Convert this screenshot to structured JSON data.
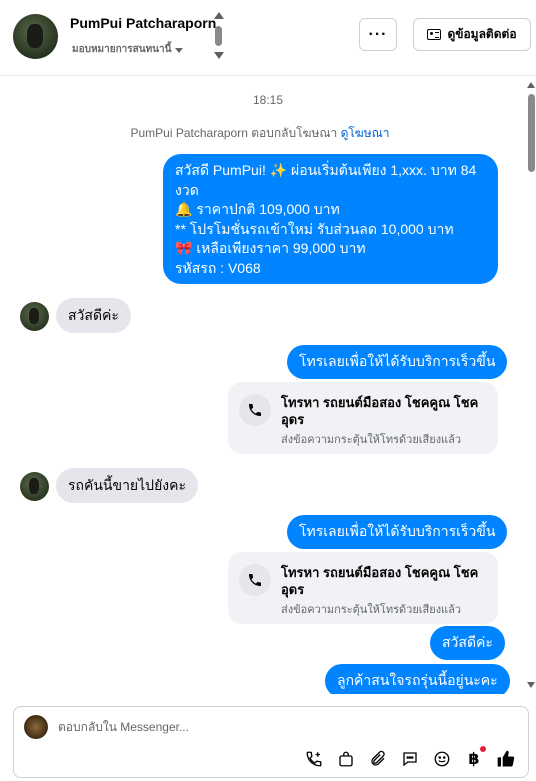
{
  "header": {
    "name": "PumPui Patcharaporn",
    "status": "มอบหมายการสนทนานี้",
    "more_label": "···",
    "contact_label": "ดูข้อมูลติดต่อ"
  },
  "chat": {
    "timestamp": "18:15",
    "notice_text": "PumPui Patcharaporn ตอบกลับโฆษณา",
    "notice_link": "ดูโฆษณา",
    "ad_message": [
      "สวัสดี PumPui! ✨  ผ่อนเริ่มต้นเพียง 1,xxx. บาท 84",
      "งวด",
      "🔔 ราคาปกติ 109,000 บาท",
      "** โปรโมชั่นรถเข้าใหม่ รับส่วนลด 10,000 บาท",
      "🎀  เหลือเพียงราคา 99,000 บาท",
      " รหัสรถ : V068"
    ],
    "incoming_1": "สวัสดีค่ะ",
    "call_button_1": "โทรเลยเพื่อให้ได้รับบริการเร็วขึ้น",
    "call_card_1": {
      "title": "โทรหา รถยนต์มือสอง โชคคูณ โชค อุดร",
      "subtitle": "ส่งข้อความกระตุ้นให้โทรด้วยเสียงแล้ว"
    },
    "incoming_2": "รถคันนี้ขายไปยังคะ",
    "call_button_2": "โทรเลยเพื่อให้ได้รับบริการเร็วขึ้น",
    "call_card_2": {
      "title": "โทรหา รถยนต์มือสอง โชคคูณ โชค อุดร",
      "subtitle": "ส่งข้อความกระตุ้นให้โทรด้วยเสียงแล้ว"
    },
    "outgoing_greeting": "สวัสดีค่ะ",
    "outgoing_last": "ลูกค้าสนใจรถรุ่นนี้อยู่นะคะ"
  },
  "composer": {
    "placeholder": "ตอบกลับใน Messenger...",
    "tools": [
      "add-call-icon",
      "shopping-bag-icon",
      "paperclip-icon",
      "saved-reply-icon",
      "emoji-icon",
      "baht-icon",
      "thumbs-up-icon"
    ]
  },
  "colors": {
    "outgoing_bubble": "#0084ff",
    "incoming_bubble": "#e4e6eb",
    "link": "#0064d1",
    "notification_dot": "#e41e3f"
  }
}
